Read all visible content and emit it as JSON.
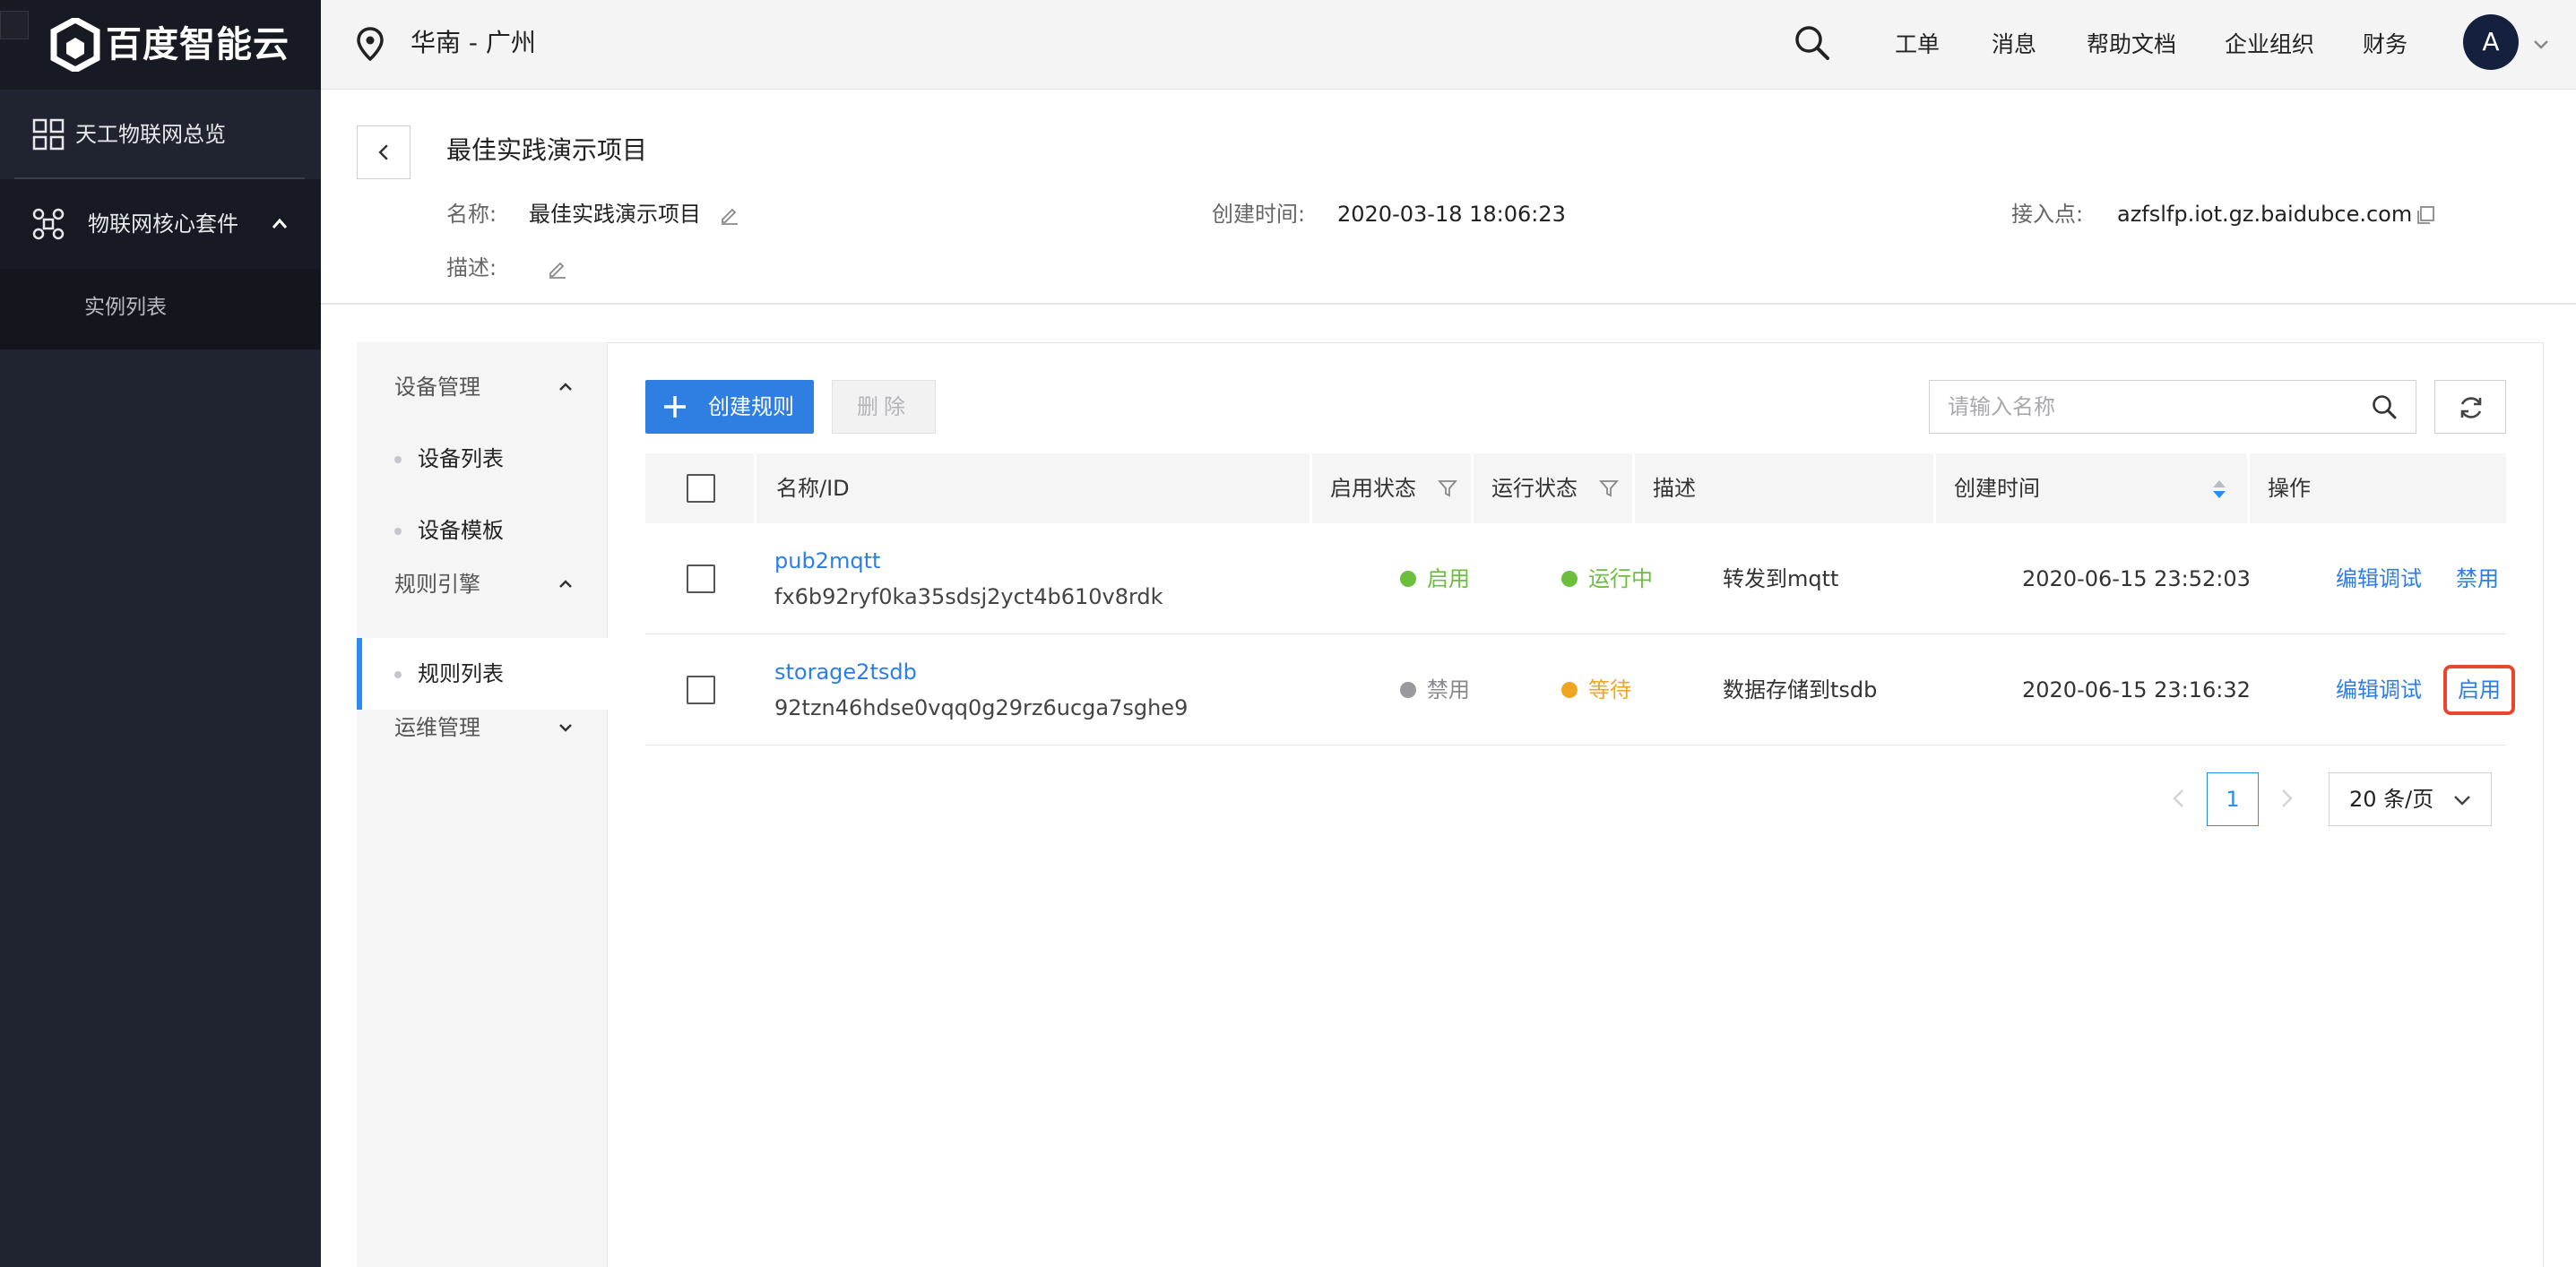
{
  "brand": {
    "logo_text": "百度智能云"
  },
  "sidebar": {
    "items": [
      {
        "label": "天工物联网总览",
        "icon": "grid-icon"
      },
      {
        "label": "物联网核心套件",
        "icon": "iot-hub-icon",
        "expanded": true
      },
      {
        "label": "实例列表"
      }
    ]
  },
  "header": {
    "region": "华南 - 广州",
    "nav": [
      "工单",
      "消息",
      "帮助文档",
      "企业组织",
      "财务"
    ],
    "avatar_letter": "A"
  },
  "project": {
    "title": "最佳实践演示项目",
    "name_label": "名称:",
    "name_value": "最佳实践演示项目",
    "created_label": "创建时间:",
    "created_value": "2020-03-18 18:06:23",
    "endpoint_label": "接入点:",
    "endpoint_value": "azfslfp.iot.gz.baidubce.com",
    "desc_label": "描述:"
  },
  "inner_nav": {
    "groups": [
      {
        "title": "设备管理",
        "expanded": true,
        "items": [
          "设备列表",
          "设备模板"
        ]
      },
      {
        "title": "规则引擎",
        "expanded": true,
        "items": [
          "规则列表"
        ]
      },
      {
        "title": "运维管理",
        "expanded": false,
        "items": []
      }
    ],
    "active_item": "规则列表"
  },
  "toolbar": {
    "create_label": "创建规则",
    "delete_label": "删除",
    "search_placeholder": "请输入名称"
  },
  "table": {
    "columns": [
      "名称/ID",
      "启用状态",
      "运行状态",
      "描述",
      "创建时间",
      "操作"
    ],
    "rows": [
      {
        "name": "pub2mqtt",
        "id": "fx6b92ryf0ka35sdsj2yct4b610v8rdk",
        "enable_status": "启用",
        "run_status": "运行中",
        "description": "转发到mqtt",
        "created": "2020-06-15 23:52:03",
        "actions": [
          "编辑调试",
          "禁用"
        ]
      },
      {
        "name": "storage2tsdb",
        "id": "92tzn46hdse0vqq0g29rz6ucga7sghe9",
        "enable_status": "禁用",
        "run_status": "等待",
        "description": "数据存储到tsdb",
        "created": "2020-06-15 23:16:32",
        "actions": [
          "编辑调试",
          "启用"
        ]
      }
    ]
  },
  "pagination": {
    "current_page": "1",
    "page_size": "20 条/页"
  },
  "colors": {
    "accent": "#2f7fe3",
    "enabled_green": "#6cbf3d",
    "disabled_gray": "#9a9a9e",
    "waiting_orange": "#f0a623",
    "highlight_red": "#e8472f"
  }
}
